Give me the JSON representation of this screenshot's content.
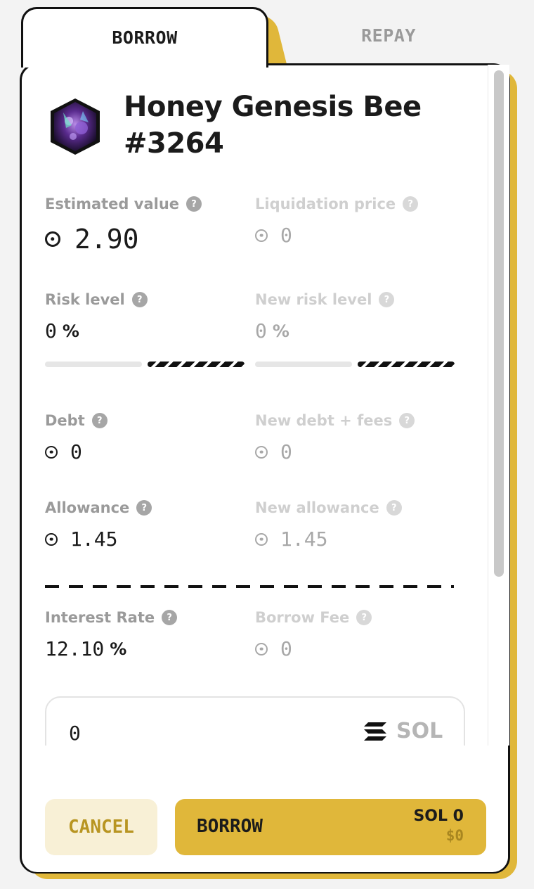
{
  "tabs": {
    "borrow": "BORROW",
    "repay": "REPAY"
  },
  "nft": {
    "name": "Honey Genesis Bee #3264"
  },
  "stats": {
    "estimated_value": {
      "label": "Estimated value",
      "value": "2.90"
    },
    "liquidation_price": {
      "label": "Liquidation price",
      "value": "0"
    },
    "risk_level": {
      "label": "Risk level",
      "value": "0",
      "unit": "%"
    },
    "new_risk_level": {
      "label": "New risk level",
      "value": "0",
      "unit": "%"
    },
    "debt": {
      "label": "Debt",
      "value": "0"
    },
    "new_debt": {
      "label": "New debt + fees",
      "value": "0"
    },
    "allowance": {
      "label": "Allowance",
      "value": "1.45"
    },
    "new_allowance": {
      "label": "New allowance",
      "value": "1.45"
    },
    "interest_rate": {
      "label": "Interest Rate",
      "value": "12.10",
      "unit": "%"
    },
    "borrow_fee": {
      "label": "Borrow Fee",
      "value": "0"
    }
  },
  "help_glyph": "?",
  "input": {
    "value": "0",
    "currency": "SOL"
  },
  "footer": {
    "cancel": "CANCEL",
    "borrow": "BORROW",
    "sol_amount": "SOL 0",
    "usd_amount": "$0"
  },
  "colors": {
    "accent": "#e0b73a",
    "cancel_bg": "#f8f0d6",
    "cancel_text": "#b89522",
    "text": "#1b1b1b",
    "muted": "#9a9a9a"
  },
  "icons": [
    "help-icon",
    "sol-coin-icon",
    "solana-logo-icon",
    "nft-avatar"
  ]
}
